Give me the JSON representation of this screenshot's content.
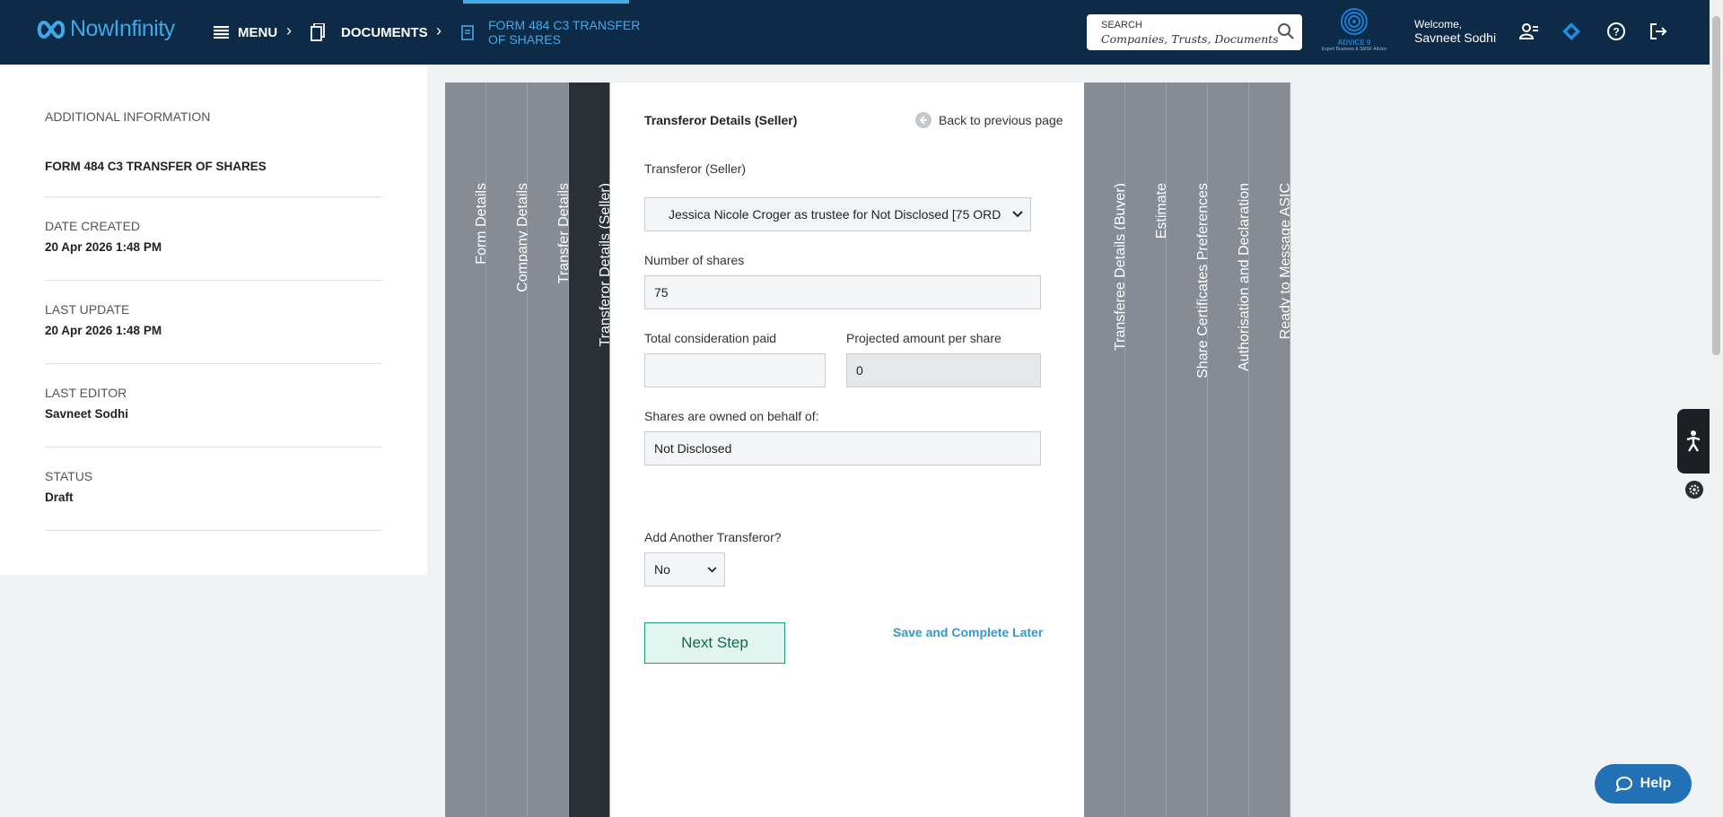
{
  "header": {
    "app_name": "NowInfinity",
    "menu_label": "MENU",
    "documents_label": "DOCUMENTS",
    "current_doc_line1": "FORM 484 C3 TRANSFER",
    "current_doc_line2": "OF SHARES",
    "search_label": "SEARCH",
    "search_placeholder": "Companies, Trusts, Documents",
    "partner_logo_text": "ADVICE 9",
    "partner_logo_sub": "Expert Business & SMSF Advice",
    "welcome_label": "Welcome,",
    "user_name": "Savneet Sodhi",
    "icons": [
      "user-card-icon",
      "diamond-icon",
      "help-circle-icon",
      "logout-icon"
    ],
    "accent_color": "#48a9e4"
  },
  "info": {
    "heading": "ADDITIONAL INFORMATION",
    "form_title": "FORM 484 C3 TRANSFER OF SHARES",
    "date_created_label": "DATE CREATED",
    "date_created": "20 Apr 2026 1:48 PM",
    "last_update_label": "LAST UPDATE",
    "last_update": "20 Apr 2026 1:48 PM",
    "last_editor_label": "LAST EDITOR",
    "last_editor": "Savneet Sodhi",
    "status_label": "STATUS",
    "status": "Draft"
  },
  "tabs": [
    {
      "label": "Form Details",
      "active": false
    },
    {
      "label": "Company Details",
      "active": false
    },
    {
      "label": "Transfer Details",
      "active": false
    },
    {
      "label": "Transferor Details (Seller)",
      "active": true
    },
    {
      "label": "Transferee Details (Buyer)",
      "active": false
    },
    {
      "label": "Estimate",
      "active": false
    },
    {
      "label": "Share Certificates Preferences",
      "active": false
    },
    {
      "label": "Authorisation and Declaration",
      "active": false
    },
    {
      "label": "Ready to Message ASIC",
      "active": false
    }
  ],
  "form": {
    "section_title": "Transferor Details (Seller)",
    "back_label": "Back to previous page",
    "transferor_label": "Transferor (Seller)",
    "transferor_value": "Jessica Nicole Croger as trustee for Not Disclosed [75 ORD",
    "shares_label": "Number of shares",
    "shares_value": "75",
    "consideration_label": "Total consideration paid",
    "consideration_value": "",
    "projected_label": "Projected amount per share",
    "projected_value": "0",
    "behalf_label": "Shares are owned on behalf of:",
    "behalf_value": "Not Disclosed",
    "another_label": "Add Another Transferor?",
    "another_value": "No",
    "next_label": "Next Step",
    "save_later_label": "Save and Complete Later"
  },
  "help_label": "Help"
}
